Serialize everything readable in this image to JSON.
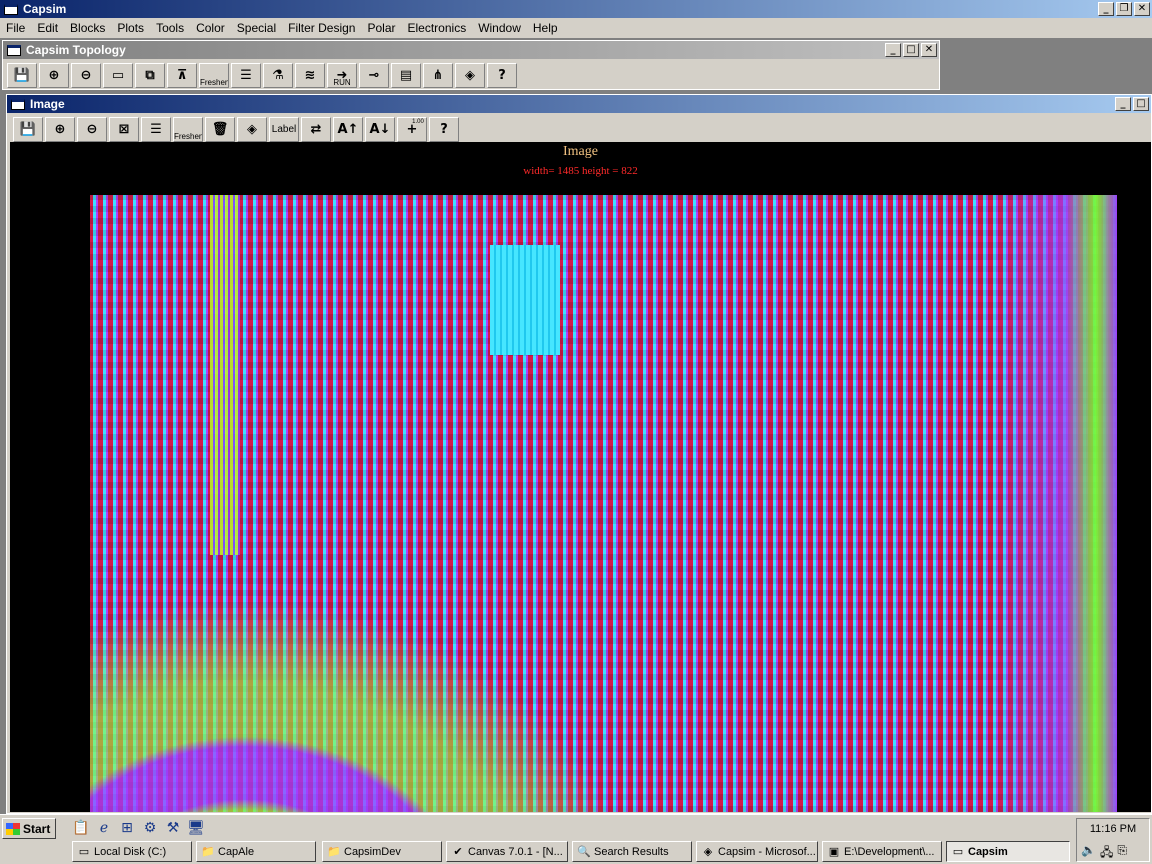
{
  "app": {
    "title": "Capsim",
    "caption_buttons": [
      "_",
      "❐",
      "✕"
    ]
  },
  "menu": [
    "File",
    "Edit",
    "Blocks",
    "Plots",
    "Tools",
    "Color",
    "Special",
    "Filter Design",
    "Polar",
    "Electronics",
    "Window",
    "Help"
  ],
  "topology": {
    "title": "Capsim Topology",
    "caption_buttons": [
      "_",
      "□",
      "✕"
    ],
    "toolbar": {
      "save_icon": "💾",
      "zoom_in_icon": "⊕",
      "zoom_out_icon": "⊖",
      "block_icon": "▭",
      "connect_icon": "⧉",
      "hierarchy_icon": "⊼",
      "freshen_label": "Freshen",
      "list_icon": "☰",
      "tool_icon": "⚗",
      "signal_icon": "≋",
      "run_arrow": "➜",
      "run_label": "RUN",
      "probe_icon": "⊸",
      "doc_icon": "▤",
      "tree_icon": "⋔",
      "plot_icon": "◈",
      "help_label": "?"
    }
  },
  "image_window": {
    "title": "Image",
    "caption_buttons": [
      "_",
      "□"
    ],
    "toolbar": {
      "save_icon": "💾",
      "zoom_in_icon": "⊕",
      "zoom_out_icon": "⊖",
      "crop_icon": "⊠",
      "list_icon": "☰",
      "freshen_label": "Freshen",
      "delete_icon": "🗑",
      "plot_icon": "◈",
      "label_text": "Label",
      "export_icon": "⇄",
      "font_up_label": "A↑",
      "font_down_label": "A↓",
      "cursor_icon": "+",
      "cursor_value": "1.00",
      "help_label": "?"
    },
    "canvas_title": "Image",
    "dimensions": "width= 1485 height = 822"
  },
  "taskbar": {
    "start_label": "Start",
    "quick_launch": [
      "📋",
      "ℯ",
      "⊞",
      "⚙",
      "⚒",
      "🖥"
    ],
    "items": [
      {
        "icon": "▭",
        "label": "Local Disk (C:)"
      },
      {
        "icon": "📁",
        "label": "CapAle"
      },
      {
        "icon": "📁",
        "label": "CapsimDev"
      },
      {
        "icon": "✔",
        "label": "Canvas 7.0.1 - [N..."
      },
      {
        "icon": "🔍",
        "label": "Search Results"
      },
      {
        "icon": "◈",
        "label": "Capsim - Microsof..."
      },
      {
        "icon": "▣",
        "label": "E:\\Development\\..."
      },
      {
        "icon": "▭",
        "label": "Capsim",
        "active": true
      }
    ],
    "clock": "11:16 PM",
    "tray_icons": [
      "🔈",
      "🖧",
      "⎘"
    ]
  }
}
